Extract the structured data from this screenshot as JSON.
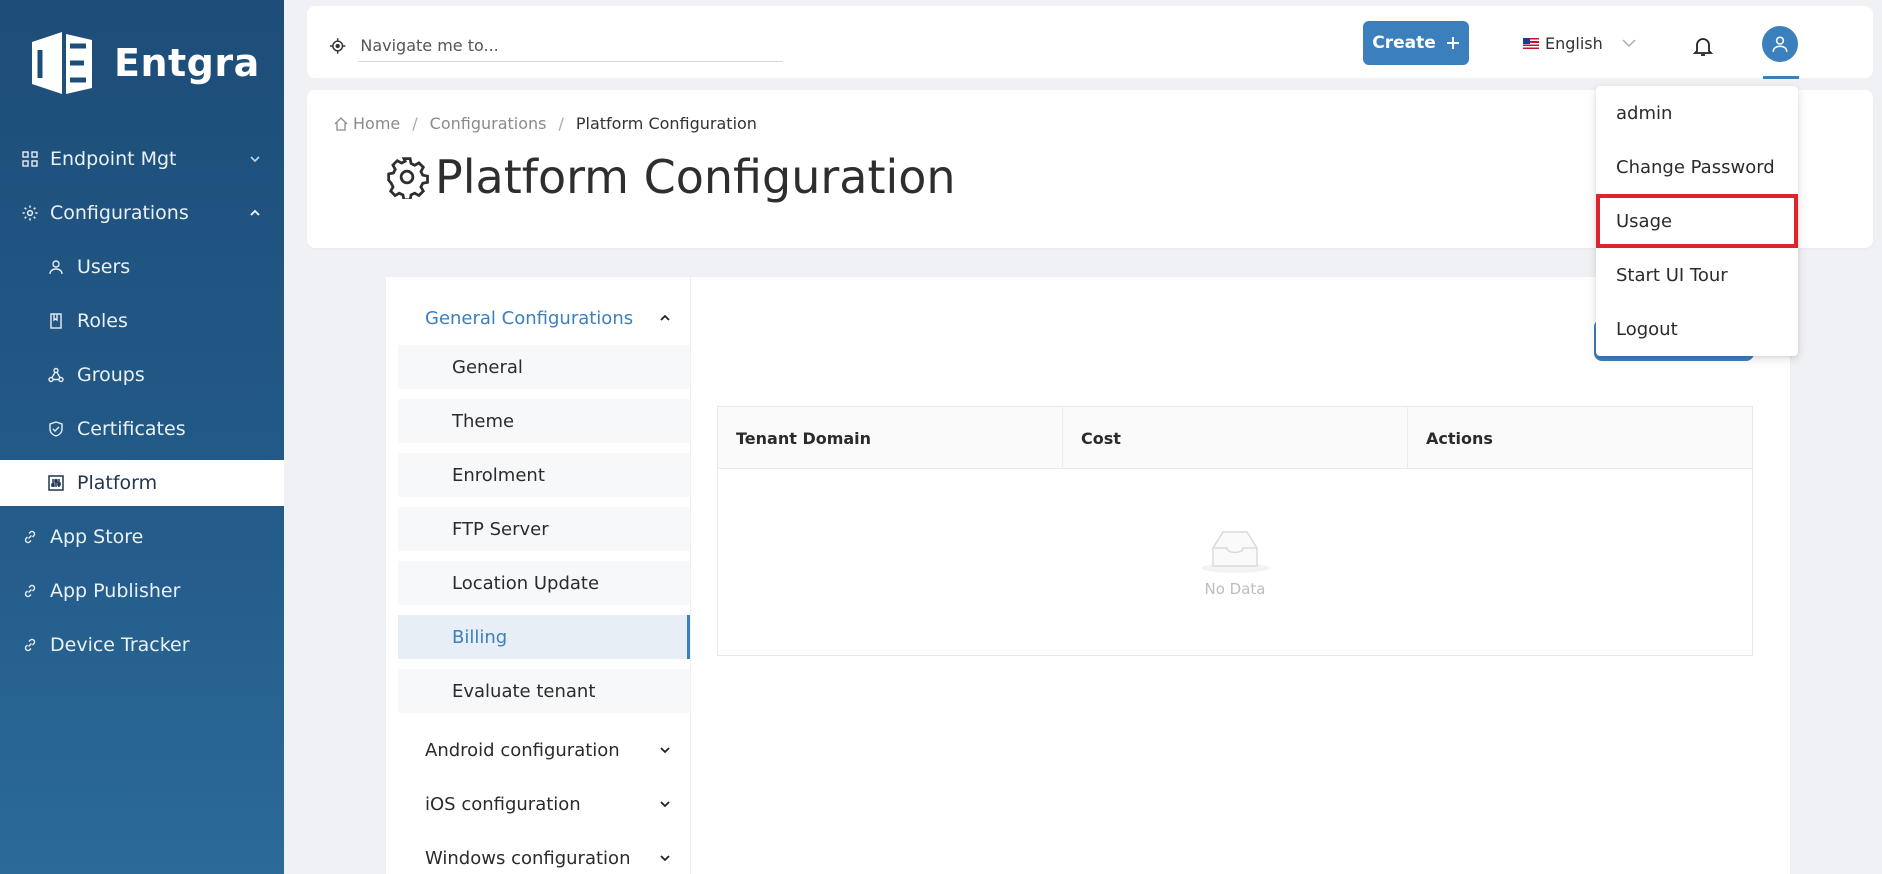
{
  "brand": {
    "name": "Entgra"
  },
  "sidebar": {
    "items": [
      {
        "label": "Endpoint Mgt",
        "icon": "grid-icon",
        "expanded": false
      },
      {
        "label": "Configurations",
        "icon": "gear-icon",
        "expanded": true
      },
      {
        "label": "Users",
        "icon": "user-icon"
      },
      {
        "label": "Roles",
        "icon": "book-icon"
      },
      {
        "label": "Groups",
        "icon": "cluster-icon"
      },
      {
        "label": "Certificates",
        "icon": "shield-check-icon"
      },
      {
        "label": "Platform",
        "icon": "sliders-icon",
        "active": true
      },
      {
        "label": "App Store",
        "icon": "link-icon"
      },
      {
        "label": "App Publisher",
        "icon": "link-icon"
      },
      {
        "label": "Device Tracker",
        "icon": "link-icon"
      }
    ]
  },
  "topbar": {
    "search_placeholder": "Navigate me to...",
    "create_label": "Create",
    "language": "English"
  },
  "breadcrumb": {
    "home": "Home",
    "level1": "Configurations",
    "current": "Platform Configuration"
  },
  "page": {
    "title": "Platform Configuration"
  },
  "config_menu": {
    "groups": [
      {
        "label": "General Configurations",
        "expanded": true
      },
      {
        "label": "Android configuration"
      },
      {
        "label": "iOS configuration"
      },
      {
        "label": "Windows configuration"
      }
    ],
    "general_items": [
      "General",
      "Theme",
      "Enrolment",
      "FTP Server",
      "Location Update",
      "Billing",
      "Evaluate tenant"
    ],
    "active_item": "Billing"
  },
  "table": {
    "columns": [
      "Tenant Domain",
      "Cost",
      "Actions"
    ],
    "empty_text": "No Data"
  },
  "user_menu": {
    "items": [
      "admin",
      "Change Password",
      "Usage",
      "Start UI Tour",
      "Logout"
    ],
    "highlighted": "Usage"
  },
  "colors": {
    "accent": "#3c7fbd",
    "sidebar": "#1d4d78",
    "highlight": "#e0242f"
  }
}
